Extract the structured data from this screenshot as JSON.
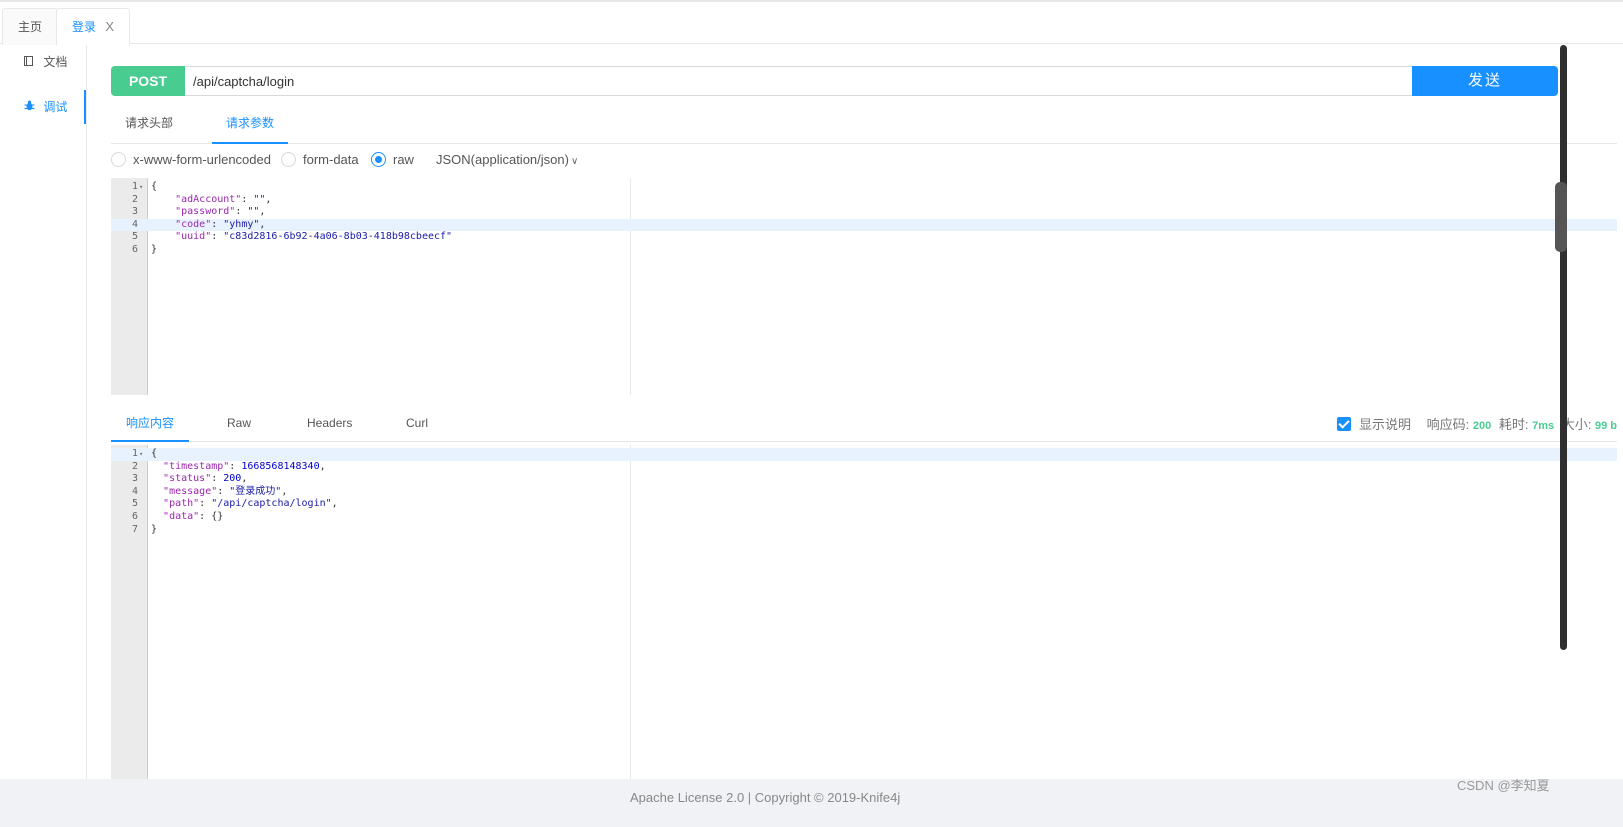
{
  "tabs": [
    {
      "label": "主页"
    },
    {
      "label": "登录",
      "close": "X"
    }
  ],
  "sidebar": {
    "items": [
      {
        "label": "文档",
        "icon": "book-icon"
      },
      {
        "label": "调试",
        "icon": "bug-icon"
      }
    ]
  },
  "request": {
    "method": "POST",
    "url": "/api/captcha/login",
    "send_label": "发送"
  },
  "request_tabs": [
    {
      "label": "请求头部"
    },
    {
      "label": "请求参数"
    }
  ],
  "body_types": {
    "options": [
      {
        "label": "x-www-form-urlencoded",
        "checked": false
      },
      {
        "label": "form-data",
        "checked": false
      },
      {
        "label": "raw",
        "checked": true
      }
    ],
    "content_type": "JSON(application/json)"
  },
  "request_body": {
    "lines": [
      {
        "num": "1",
        "text": "{"
      },
      {
        "num": "2",
        "text": "    \"adAccount\": \"\","
      },
      {
        "num": "3",
        "text": "    \"password\": \"\","
      },
      {
        "num": "4",
        "text": "    \"code\": \"yhmy\","
      },
      {
        "num": "5",
        "text": "    \"uuid\": \"c83d2816-6b92-4a06-8b03-418b98cbeecf\""
      },
      {
        "num": "6",
        "text": "}"
      }
    ]
  },
  "response_tabs": [
    {
      "label": "响应内容"
    },
    {
      "label": "Raw"
    },
    {
      "label": "Headers"
    },
    {
      "label": "Curl"
    }
  ],
  "response_meta": {
    "show_desc_label": "显示说明",
    "code_label": "响应码:",
    "code_value": "200",
    "time_label": "耗时:",
    "time_value": "7ms",
    "size_label": "大小:",
    "size_value": "99 b"
  },
  "response_body": {
    "lines": [
      {
        "num": "1",
        "text": "{"
      },
      {
        "num": "2",
        "text": "  \"timestamp\": 1668568148340,"
      },
      {
        "num": "3",
        "text": "  \"status\": 200,"
      },
      {
        "num": "4",
        "text": "  \"message\": \"登录成功\","
      },
      {
        "num": "5",
        "text": "  \"path\": \"/api/captcha/login\","
      },
      {
        "num": "6",
        "text": "  \"data\": {}"
      },
      {
        "num": "7",
        "text": "}"
      }
    ]
  },
  "footer": {
    "license": "Apache License 2.0 | Copyright © 2019-Knife4j",
    "watermark": "CSDN @李知夏"
  },
  "colors": {
    "accent": "#1890ff",
    "post_method": "#49cc90",
    "success": "#49cc90"
  }
}
